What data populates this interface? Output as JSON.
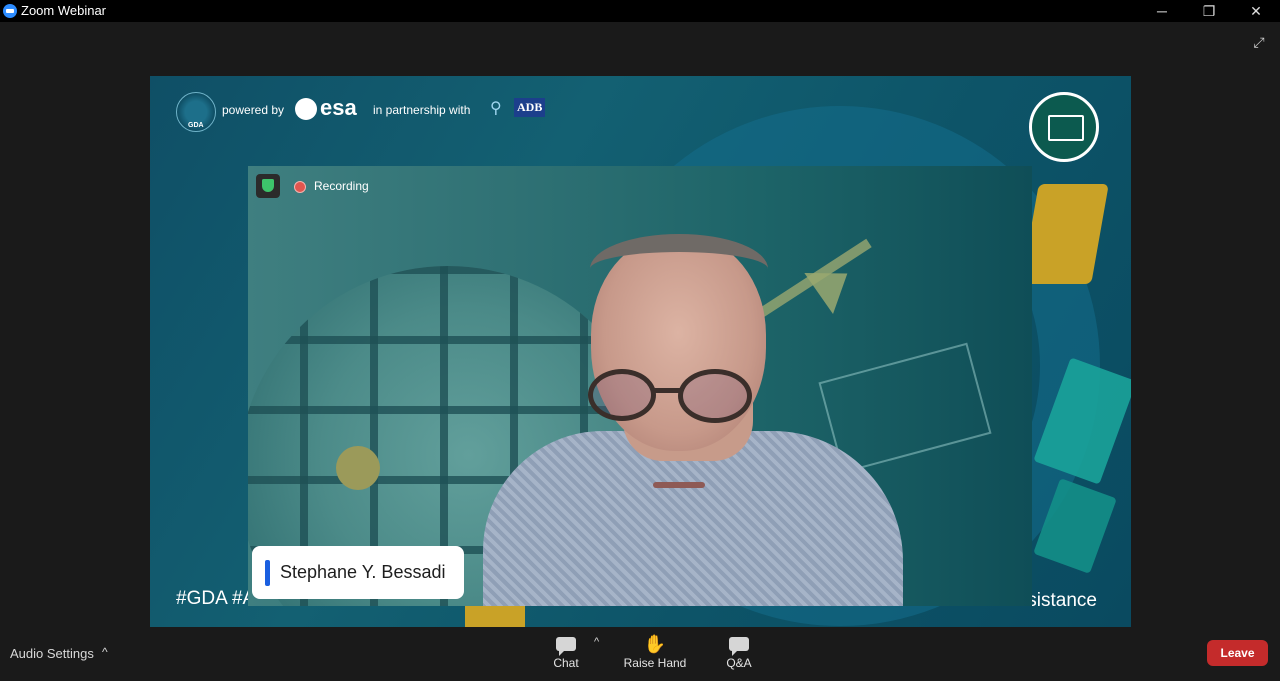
{
  "window": {
    "title": "Zoom Webinar",
    "minimize": "─",
    "maximize": "❐",
    "close": "✕",
    "fullscreen": "⤢"
  },
  "shared_screen": {
    "powered_by": "powered by",
    "esa": "esa",
    "partnership": "in partnership with",
    "adb": "ADB",
    "gda": "GDA",
    "hashtag_left": "#GDA #A",
    "hashtag_right": "sistance"
  },
  "video": {
    "recording": "Recording",
    "speaker_name": "Stephane Y. Bessadi"
  },
  "toolbar": {
    "audio_settings": "Audio Settings",
    "chevron_up": "^",
    "chat": "Chat",
    "raise_hand": "Raise Hand",
    "qa": "Q&A",
    "leave": "Leave"
  }
}
